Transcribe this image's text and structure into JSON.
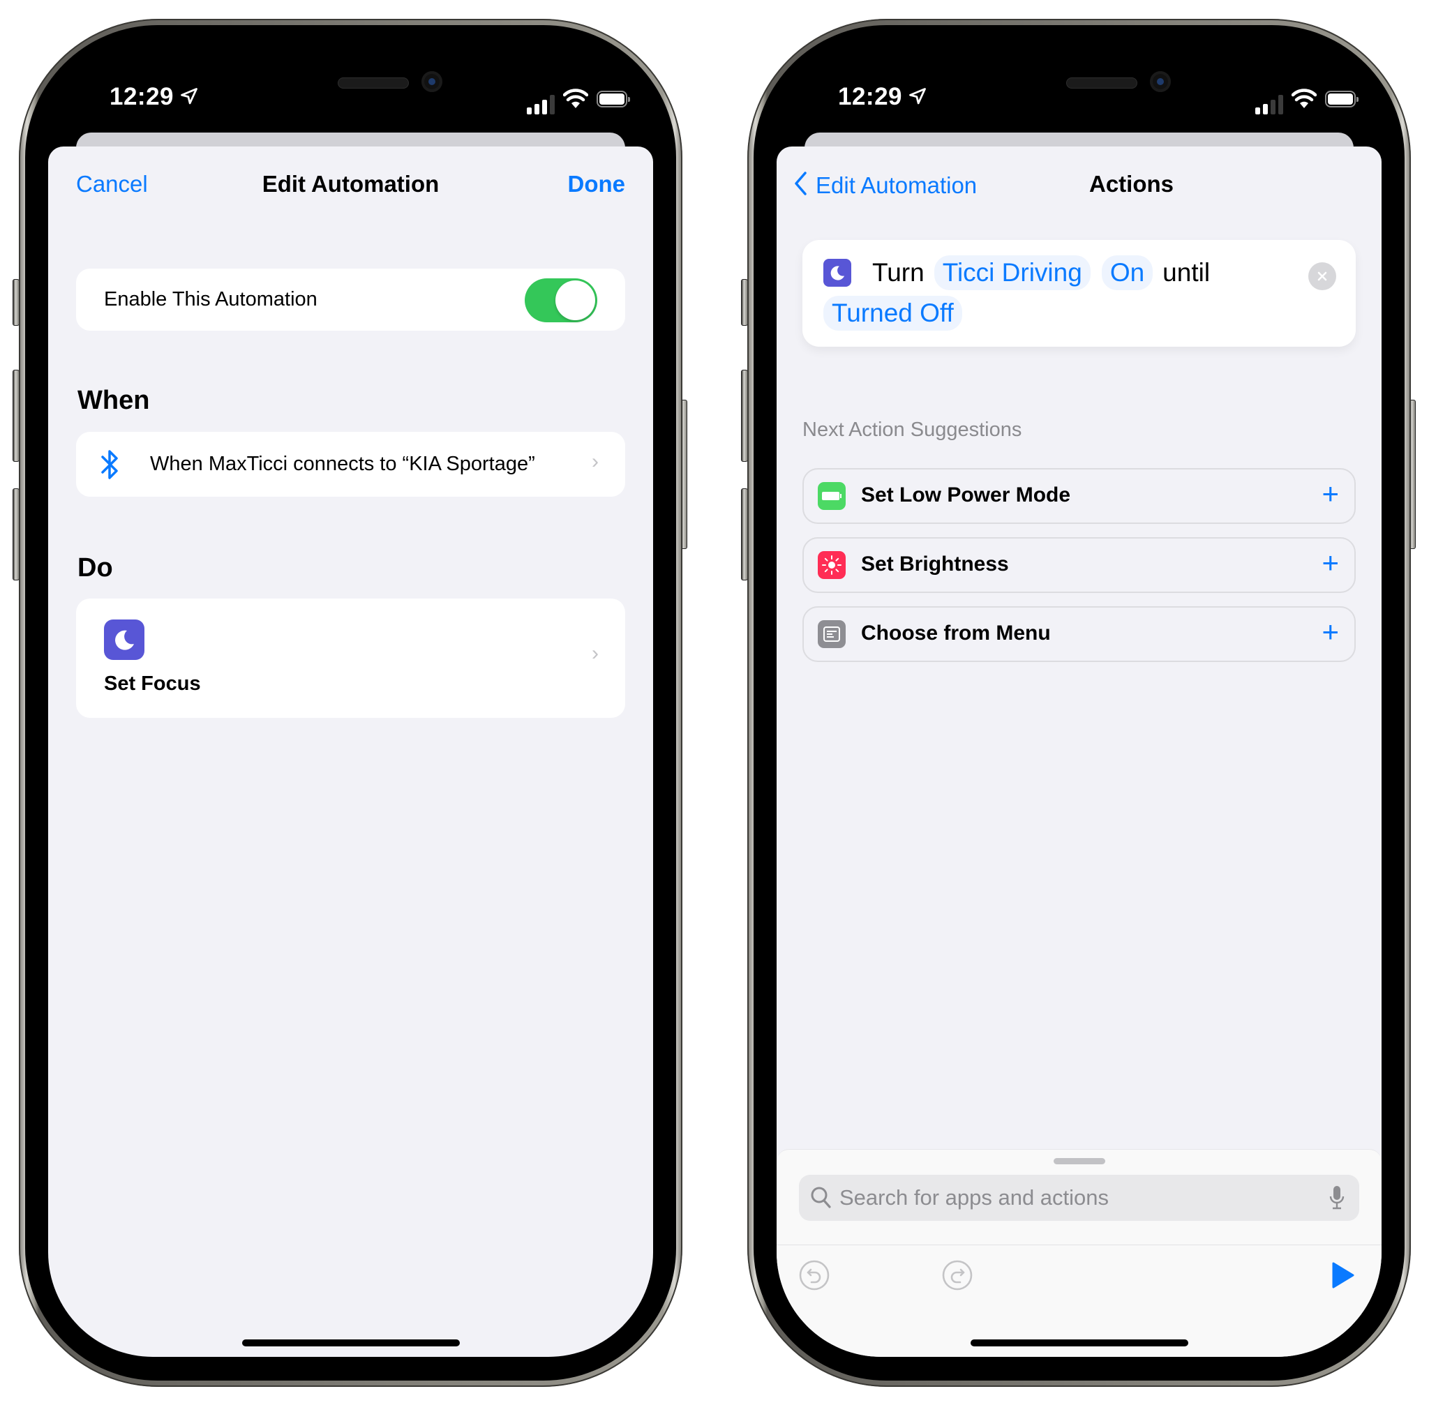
{
  "left_phone": {
    "status_bar": {
      "time": "12:29",
      "location_icon": "location-arrow-icon",
      "signal_bars_filled": 3,
      "signal_bars_total": 4,
      "wifi_icon": "wifi-icon",
      "battery_icon": "battery-icon"
    },
    "nav": {
      "cancel_label": "Cancel",
      "title": "Edit Automation",
      "done_label": "Done"
    },
    "enable_row": {
      "label": "Enable This Automation",
      "toggle_on": true
    },
    "when_section": {
      "heading": "When",
      "trigger": {
        "icon": "bluetooth-icon",
        "text": "When MaxTicci connects to “KIA Sportage”"
      }
    },
    "do_section": {
      "heading": "Do",
      "action": {
        "icon": "moon-icon",
        "label": "Set Focus"
      }
    }
  },
  "right_phone": {
    "status_bar": {
      "time": "12:29",
      "location_icon": "location-arrow-icon",
      "signal_bars_filled": 2,
      "signal_bars_total": 4,
      "wifi_icon": "wifi-icon",
      "battery_icon": "battery-icon"
    },
    "nav": {
      "back_label": "Edit Automation",
      "title": "Actions"
    },
    "action_card": {
      "icon": "moon-icon",
      "word_turn": "Turn",
      "focus_param": "Ticci Driving",
      "state_param": "On",
      "word_until": "until",
      "until_param": "Turned Off"
    },
    "suggestions": {
      "heading": "Next Action Suggestions",
      "items": [
        {
          "label": "Set Low Power Mode",
          "icon": "battery-icon",
          "color": "#4cd964"
        },
        {
          "label": "Set Brightness",
          "icon": "sun-icon",
          "color": "#ff2d55"
        },
        {
          "label": "Choose from Menu",
          "icon": "menu-icon",
          "color": "#8e8e93"
        }
      ]
    },
    "search": {
      "placeholder": "Search for apps and actions"
    },
    "toolbar": {
      "undo_icon": "undo-icon",
      "redo_icon": "redo-icon",
      "run_icon": "play-icon"
    }
  },
  "colors": {
    "accent": "#0a7aff",
    "toggle_green": "#34c759",
    "focus_purple": "#5856d6",
    "background": "#f2f2f7"
  }
}
